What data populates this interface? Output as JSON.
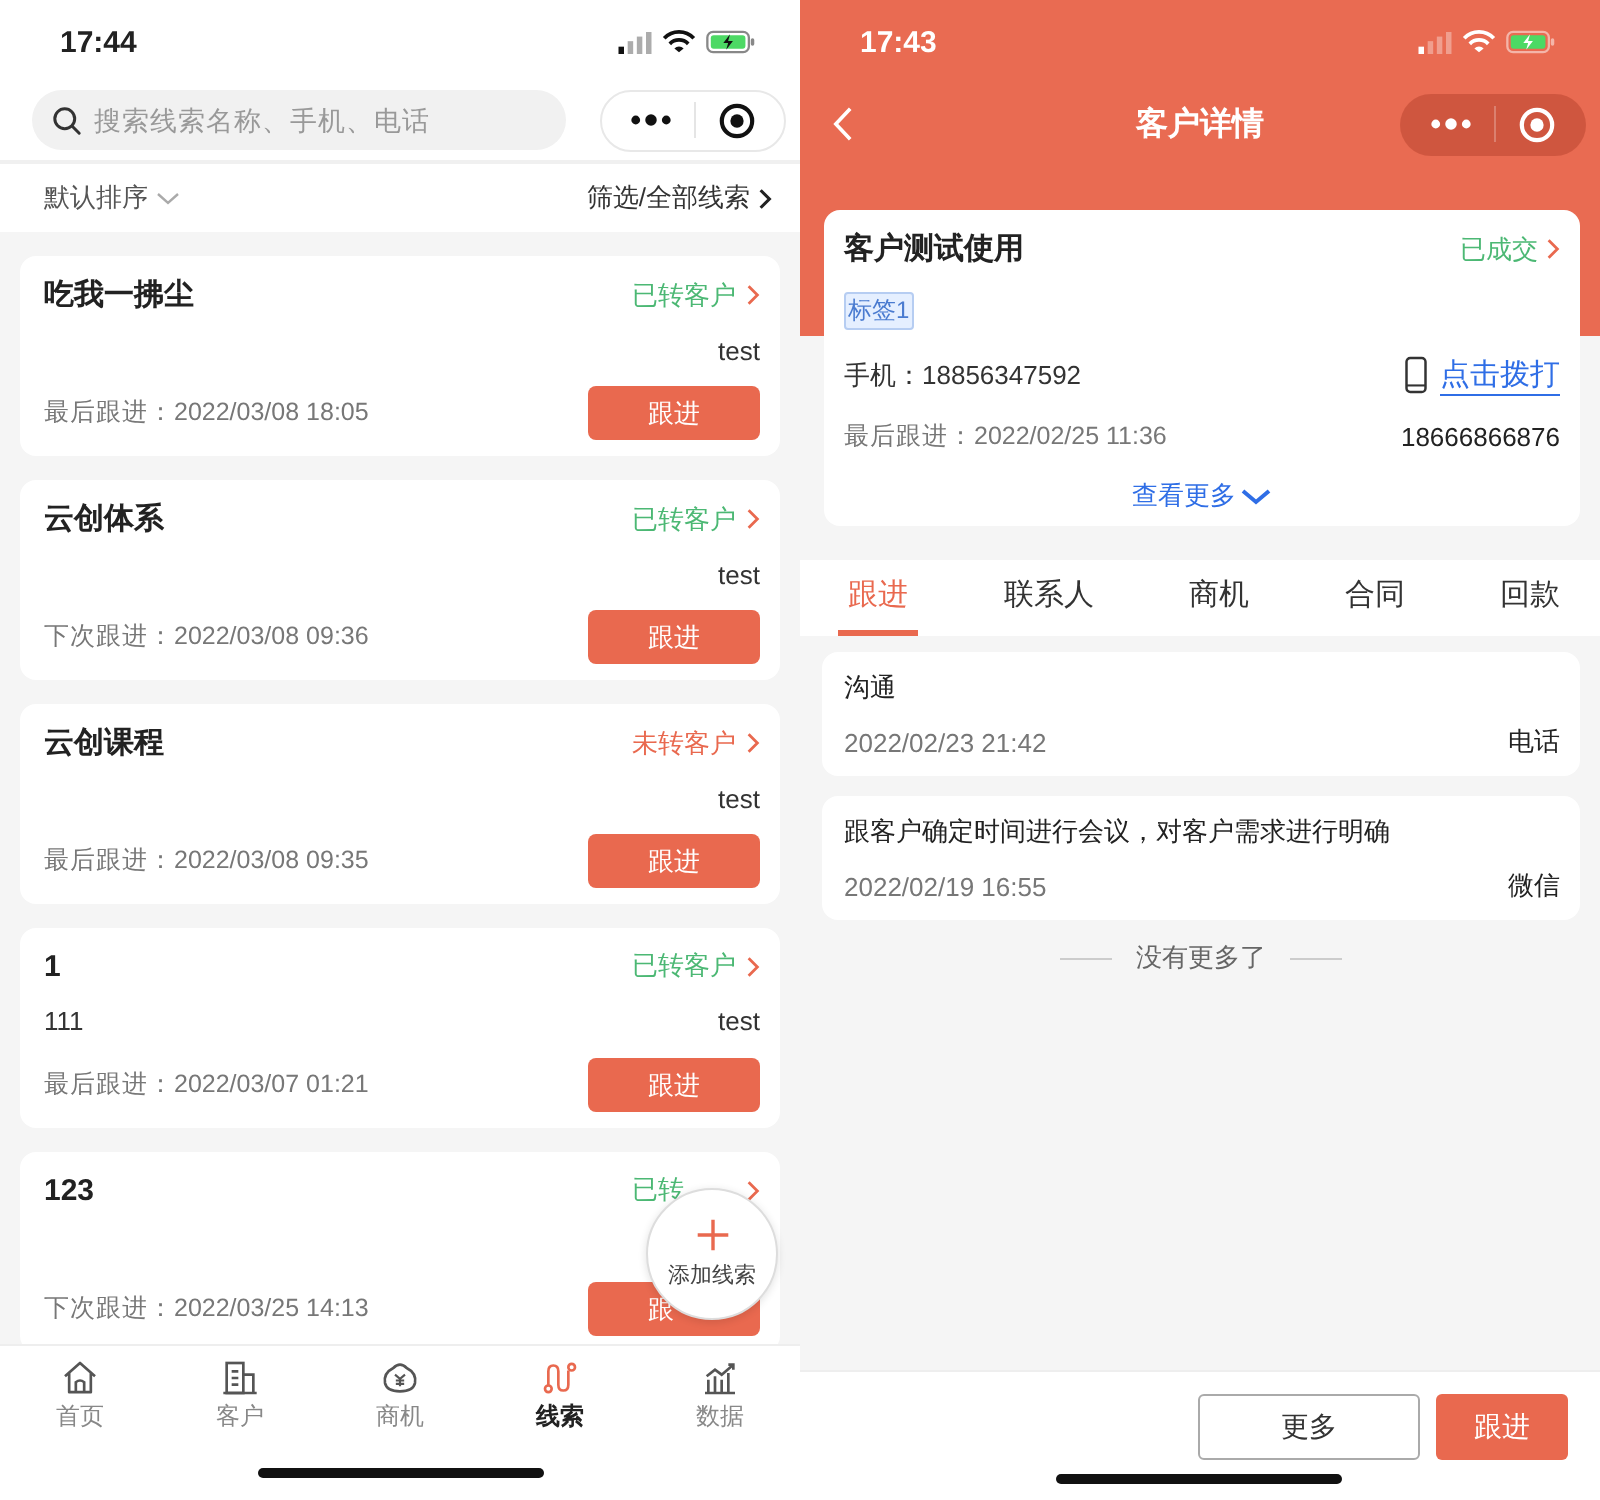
{
  "left": {
    "status_bar": {
      "time": "17:44"
    },
    "search": {
      "placeholder": "搜索线索名称、手机、电话"
    },
    "sort": {
      "label": "默认排序",
      "filter": "筛选/全部线索"
    },
    "leads": [
      {
        "name": "吃我一拂尘",
        "status": {
          "text": "已转客户",
          "color": "#4cb874"
        },
        "note": "test",
        "follow": "最后跟进：2022/03/08 18:05",
        "action": "跟进"
      },
      {
        "name": "云创体系",
        "status": {
          "text": "已转客户",
          "color": "#4cb874"
        },
        "note": "test",
        "follow": "下次跟进：2022/03/08 09:36",
        "action": "跟进"
      },
      {
        "name": "云创课程",
        "status": {
          "text": "未转客户",
          "color": "#e9694f"
        },
        "note": "test",
        "follow": "最后跟进：2022/03/08 09:35",
        "action": "跟进"
      },
      {
        "name": "1",
        "status": {
          "text": "已转客户",
          "color": "#4cb874"
        },
        "extra": "111",
        "note": "test",
        "follow": "最后跟进：2022/03/07 01:21",
        "action": "跟进"
      },
      {
        "name": "123",
        "status": {
          "text": "已转",
          "color": "#4cb874"
        },
        "follow": "下次跟进：2022/03/25 14:13",
        "action": "跟"
      }
    ],
    "fab": {
      "label": "添加线索"
    },
    "tab_bar": [
      {
        "label": "首页",
        "kind": "home",
        "selected": false
      },
      {
        "label": "客户",
        "kind": "building",
        "selected": false
      },
      {
        "label": "商机",
        "kind": "bag",
        "selected": false
      },
      {
        "label": "线索",
        "kind": "route",
        "selected": true
      },
      {
        "label": "数据",
        "kind": "chart",
        "selected": false
      }
    ]
  },
  "right": {
    "status_bar": {
      "time": "17:43"
    },
    "nav": {
      "title": "客户详情"
    },
    "customer": {
      "name": "客户测试使用",
      "status": {
        "text": "已成交",
        "color": "#4cb874"
      },
      "tag": "标签1",
      "mobile": "手机：18856347592",
      "call": "点击拨打",
      "follow": "最后跟进：2022/02/25 11:36",
      "phone": "18666866876",
      "more": "查看更多"
    },
    "tabs": [
      {
        "label": "跟进",
        "selected": true
      },
      {
        "label": "联系人",
        "selected": false
      },
      {
        "label": "商机",
        "selected": false
      },
      {
        "label": "合同",
        "selected": false
      },
      {
        "label": "回款",
        "selected": false
      }
    ],
    "records": [
      {
        "content": "沟通",
        "time": "2022/02/23 21:42",
        "method": "电话"
      },
      {
        "content": "跟客户确定时间进行会议，对客户需求进行明确",
        "time": "2022/02/19 16:55",
        "method": "微信"
      }
    ],
    "end_note": "没有更多了",
    "buttons": [
      {
        "label": "更多",
        "kind": "secondary"
      },
      {
        "label": "跟进",
        "kind": "primary"
      }
    ]
  }
}
